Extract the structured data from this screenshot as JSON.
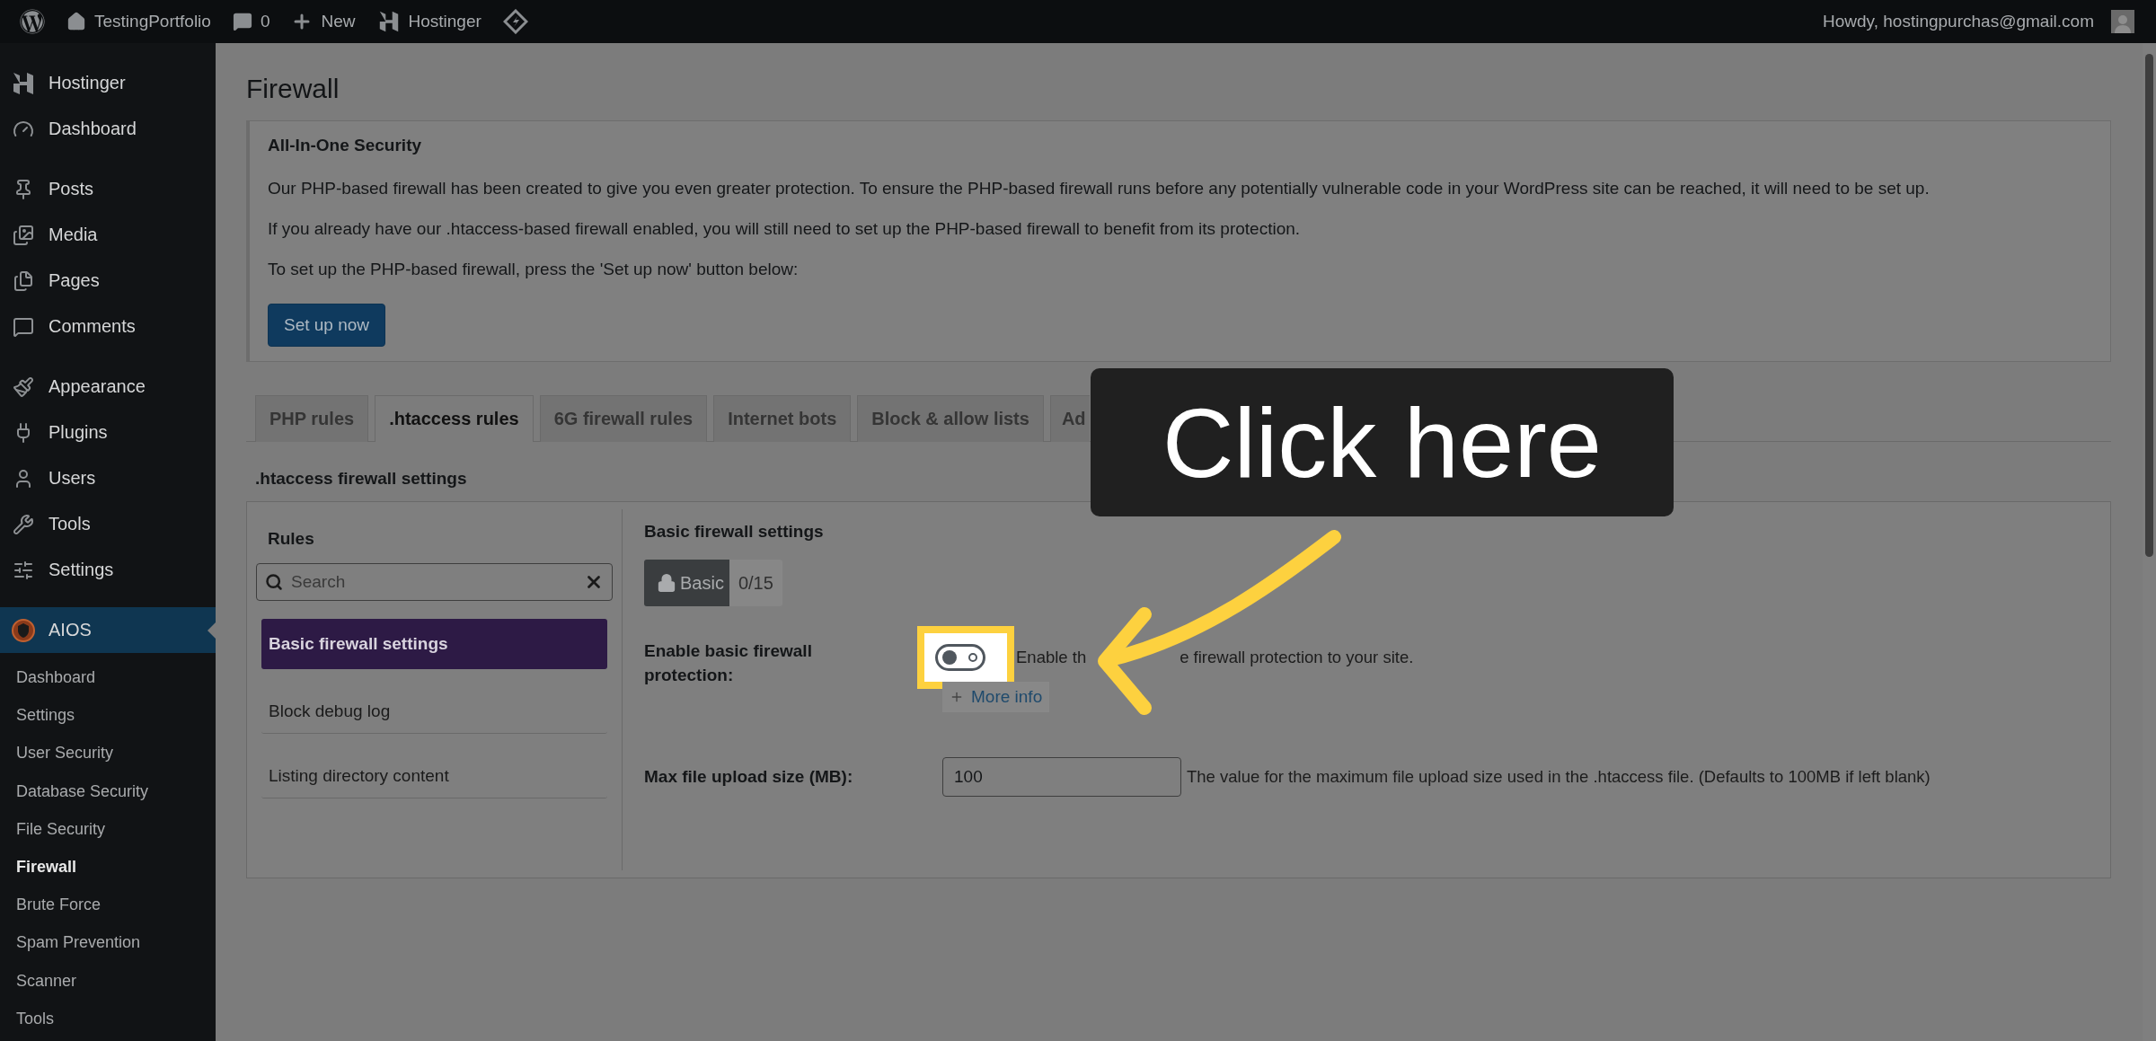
{
  "admin_bar": {
    "site_name": "TestingPortfolio",
    "comments_count": "0",
    "new_label": "New",
    "hostinger_label": "Hostinger",
    "greeting": "Howdy, hostingpurchas@gmail.com"
  },
  "sidebar": {
    "groups": [
      {
        "items": [
          {
            "label": "Hostinger",
            "kind": "hostinger",
            "selected": false
          },
          {
            "label": "Dashboard",
            "kind": "dashboard",
            "selected": false
          }
        ]
      },
      {
        "items": [
          {
            "label": "Posts",
            "kind": "posts",
            "selected": false
          },
          {
            "label": "Media",
            "kind": "media",
            "selected": false
          },
          {
            "label": "Pages",
            "kind": "pages",
            "selected": false
          },
          {
            "label": "Comments",
            "kind": "comments",
            "selected": false
          }
        ]
      },
      {
        "items": [
          {
            "label": "Appearance",
            "kind": "appearance",
            "selected": false
          },
          {
            "label": "Plugins",
            "kind": "plugins",
            "selected": false
          },
          {
            "label": "Users",
            "kind": "users",
            "selected": false
          },
          {
            "label": "Tools",
            "kind": "tools",
            "selected": false
          },
          {
            "label": "Settings",
            "kind": "settings",
            "selected": false
          }
        ]
      },
      {
        "items": [
          {
            "label": "AIOS",
            "kind": "aios",
            "selected": true
          }
        ]
      }
    ],
    "submenu": [
      {
        "label": "Dashboard",
        "selected": false
      },
      {
        "label": "Settings",
        "selected": false
      },
      {
        "label": "User Security",
        "selected": false
      },
      {
        "label": "Database Security",
        "selected": false
      },
      {
        "label": "File Security",
        "selected": false
      },
      {
        "label": "Firewall",
        "selected": true
      },
      {
        "label": "Brute Force",
        "selected": false
      },
      {
        "label": "Spam Prevention",
        "selected": false
      },
      {
        "label": "Scanner",
        "selected": false
      },
      {
        "label": "Tools",
        "selected": false
      }
    ]
  },
  "page_title": "Firewall",
  "notice": {
    "title": "All-In-One Security",
    "paragraphs": [
      "Our PHP-based firewall has been created to give you even greater protection. To ensure the PHP-based firewall runs before any potentially vulnerable code in your WordPress site can be reached, it will need to be set up.",
      "If you already have our .htaccess-based firewall enabled, you will still need to set up the PHP-based firewall to benefit from its protection.",
      "To set up the PHP-based firewall, press the 'Set up now' button below:"
    ],
    "button": "Set up now"
  },
  "tabs": [
    {
      "label": "PHP rules",
      "selected": false
    },
    {
      "label": ".htaccess rules",
      "selected": true
    },
    {
      "label": "6G firewall rules",
      "selected": false
    },
    {
      "label": "Internet bots",
      "selected": false
    },
    {
      "label": "Block & allow lists",
      "selected": false
    },
    {
      "label": "Ad",
      "selected": false
    }
  ],
  "section_title": ".htaccess firewall settings",
  "rules_panel": {
    "title": "Rules",
    "search": {
      "placeholder": "Search"
    },
    "items": [
      {
        "label": "Basic firewall settings",
        "selected": true
      },
      {
        "label": "Block debug log",
        "selected": false
      },
      {
        "label": "Listing directory content",
        "selected": false
      }
    ]
  },
  "settings": {
    "title": "Basic firewall settings",
    "badge": {
      "label": "Basic",
      "count": "0/15"
    },
    "rows": [
      {
        "kind": "toggle",
        "label": "Enable basic firewall protection:",
        "on": false,
        "description_parts": [
          "Enable th",
          "e firewall protection to your site."
        ],
        "more_info": "More info"
      },
      {
        "kind": "number",
        "label": "Max file upload size (MB):",
        "value": "100",
        "description": "The value for the maximum file upload size used in the .htaccess file. (Defaults to 100MB if left blank)"
      }
    ]
  },
  "callout": {
    "text": "Click here"
  }
}
